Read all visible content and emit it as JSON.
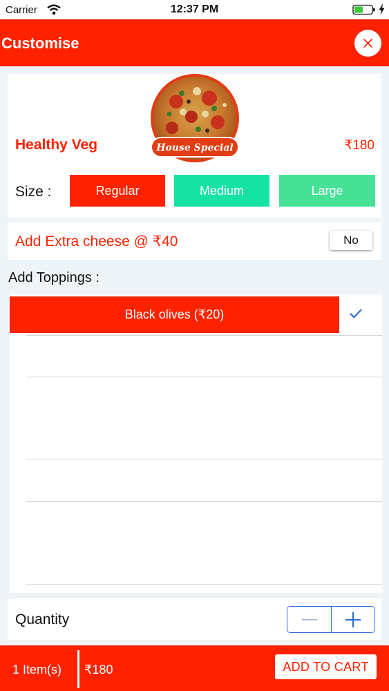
{
  "status_bar": {
    "carrier": "Carrier",
    "time": "12:37 PM"
  },
  "header": {
    "title": "Customise",
    "close_icon": "close-icon"
  },
  "product": {
    "name": "Healthy Veg",
    "price": "₹180",
    "image_badge": "House Special",
    "size_label": "Size :",
    "sizes": [
      {
        "label": "Regular",
        "selected": true,
        "color": "#ff2200"
      },
      {
        "label": "Medium",
        "selected": false,
        "color": "#16e3a2"
      },
      {
        "label": "Large",
        "selected": false,
        "color": "#46e096"
      }
    ]
  },
  "extra_cheese": {
    "label": "Add Extra cheese @ ₹40",
    "value": "No"
  },
  "toppings": {
    "heading": "Add Toppings :",
    "items": [
      {
        "label": "Black olives (₹20)",
        "selected": true
      }
    ]
  },
  "quantity": {
    "label": "Quantity",
    "minus_icon": "minus-icon",
    "plus_icon": "plus-icon"
  },
  "footer": {
    "item_count": "1 Item(s)",
    "total": "₹180",
    "add_to_cart": "ADD TO CART"
  },
  "colors": {
    "brand": "#ff2200",
    "accent_blue": "#2a6bd8"
  }
}
